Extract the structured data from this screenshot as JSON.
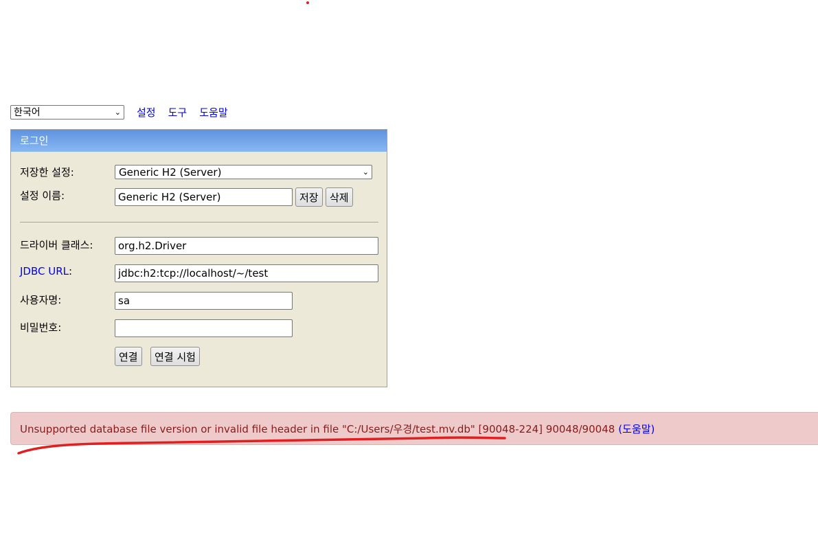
{
  "topbar": {
    "language": "한국어",
    "links": [
      "설정",
      "도구",
      "도움말"
    ]
  },
  "login": {
    "header": "로그인",
    "saved_settings_label": "저장한 설정:",
    "saved_settings_value": "Generic H2 (Server)",
    "setting_name_label": "설정 이름:",
    "setting_name_value": "Generic H2 (Server)",
    "save_button": "저장",
    "delete_button": "삭제",
    "driver_class_label": "드라이버 클래스:",
    "driver_class_value": "org.h2.Driver",
    "jdbc_url_label": "JDBC URL",
    "jdbc_url_colon": ":",
    "jdbc_url_value": "jdbc:h2:tcp://localhost/~/test",
    "username_label": "사용자명:",
    "username_value": "sa",
    "password_label": "비밀번호:",
    "password_value": "",
    "connect_button": "연결",
    "test_connect_button": "연결 시험"
  },
  "error": {
    "message": "Unsupported database file version or invalid file header in file \"C:/Users/우경/test.mv.db\" [90048-224] 90048/90048",
    "help_link": "(도움말)"
  },
  "colors": {
    "annotation": "#e02020",
    "link": "#0000ee",
    "panel_bg": "#ece9d8",
    "error_bg": "#eecaca"
  }
}
